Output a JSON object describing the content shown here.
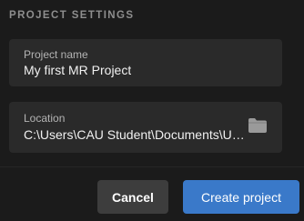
{
  "section": {
    "title": "PROJECT SETTINGS"
  },
  "project_name": {
    "label": "Project name",
    "value": "My first MR Project"
  },
  "location": {
    "label": "Location",
    "value": "C:\\Users\\CAU Student\\Documents\\Unity Projects",
    "browse_icon": "folder-icon"
  },
  "buttons": {
    "cancel": "Cancel",
    "create": "Create project"
  },
  "colors": {
    "background": "#1b1b1b",
    "field_background": "#2a2a2a",
    "accent": "#3a79c9",
    "secondary_button": "#3d3d3d"
  }
}
